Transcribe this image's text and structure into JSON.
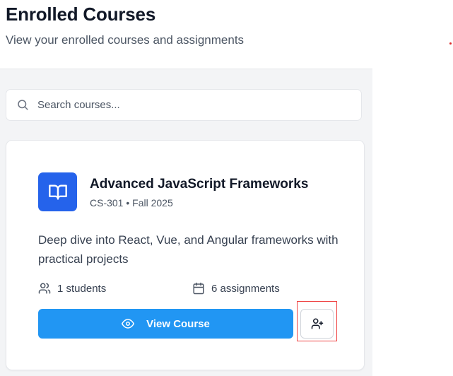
{
  "header": {
    "title": "Enrolled Courses",
    "subtitle": "View your enrolled courses and assignments"
  },
  "search": {
    "placeholder": "Search courses...",
    "value": "",
    "icon": "search-icon"
  },
  "course": {
    "icon": "book-open-icon",
    "title": "Advanced JavaScript Frameworks",
    "meta": "CS-301 • Fall 2025",
    "description": "Deep dive into React, Vue, and Angular frameworks with practical projects",
    "students_icon": "users-icon",
    "students_label": "1 students",
    "assignments_icon": "calendar-icon",
    "assignments_label": "6 assignments",
    "view_button_label": "View Course",
    "view_button_icon": "eye-icon",
    "enroll_button_icon": "user-plus-icon"
  },
  "colors": {
    "accent": "#2196f3",
    "course_icon_bg": "#2563eb",
    "panel_bg": "#f3f4f6",
    "highlight": "#ef4444"
  }
}
